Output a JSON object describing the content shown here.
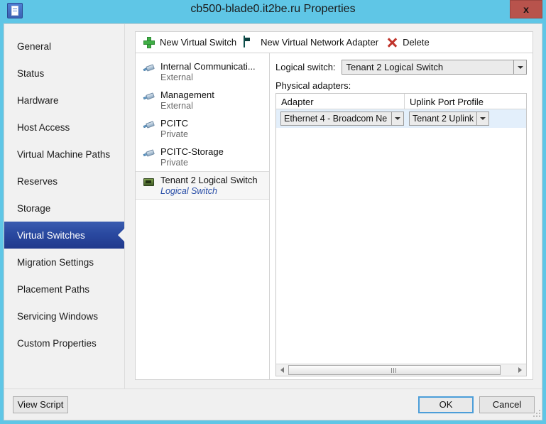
{
  "window": {
    "title": "cb500-blade0.it2be.ru Properties",
    "icon": "host-properties-icon",
    "close_label": "x",
    "titlebar_color": "#5fc6e6"
  },
  "sidebar": {
    "items": [
      {
        "label": "General",
        "selected": false
      },
      {
        "label": "Status",
        "selected": false
      },
      {
        "label": "Hardware",
        "selected": false
      },
      {
        "label": "Host Access",
        "selected": false
      },
      {
        "label": "Virtual Machine Paths",
        "selected": false
      },
      {
        "label": "Reserves",
        "selected": false
      },
      {
        "label": "Storage",
        "selected": false
      },
      {
        "label": "Virtual Switches",
        "selected": true
      },
      {
        "label": "Migration Settings",
        "selected": false
      },
      {
        "label": "Placement Paths",
        "selected": false
      },
      {
        "label": "Servicing Windows",
        "selected": false
      },
      {
        "label": "Custom Properties",
        "selected": false
      }
    ],
    "selected_color": "#2a49a0"
  },
  "toolbar": {
    "buttons": [
      {
        "label": "New Virtual Switch",
        "icon": "plus-icon"
      },
      {
        "label": "New Virtual Network Adapter",
        "icon": "network-adapter-icon"
      },
      {
        "label": "Delete",
        "icon": "delete-x-icon"
      }
    ]
  },
  "switch_list": {
    "items": [
      {
        "name": "Internal Communicati...",
        "type": "External",
        "icon": "network-cable-icon",
        "selected": false,
        "logical": false
      },
      {
        "name": "Management",
        "type": "External",
        "icon": "network-cable-icon",
        "selected": false,
        "logical": false
      },
      {
        "name": "PCITC",
        "type": "Private",
        "icon": "network-cable-icon",
        "selected": false,
        "logical": false
      },
      {
        "name": "PCITC-Storage",
        "type": "Private",
        "icon": "network-cable-icon",
        "selected": false,
        "logical": false
      },
      {
        "name": "Tenant 2 Logical Switch",
        "type": "Logical Switch",
        "icon": "logical-switch-icon",
        "selected": true,
        "logical": true
      }
    ]
  },
  "detail": {
    "logical_switch_label": "Logical switch:",
    "logical_switch_value": "Tenant 2 Logical Switch",
    "physical_adapters_label": "Physical adapters:",
    "table": {
      "columns": [
        "Adapter",
        "Uplink Port Profile"
      ],
      "rows": [
        {
          "adapter": "Ethernet 4 - Broadcom Ne",
          "uplink": "Tenant 2 Uplink",
          "selected": true
        }
      ]
    },
    "row_selected_color": "#e3effb"
  },
  "footer": {
    "view_script_label": "View Script",
    "ok_label": "OK",
    "cancel_label": "Cancel"
  }
}
